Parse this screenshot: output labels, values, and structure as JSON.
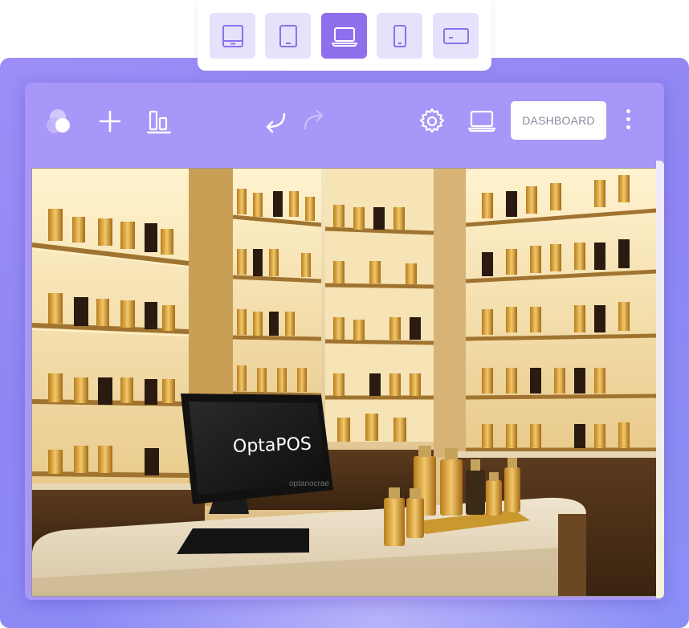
{
  "device_switcher": {
    "devices": [
      {
        "name": "desktop-monitor",
        "active": false
      },
      {
        "name": "tablet-portrait",
        "active": false
      },
      {
        "name": "laptop",
        "active": true
      },
      {
        "name": "mobile-portrait",
        "active": false
      },
      {
        "name": "tablet-landscape",
        "active": false
      }
    ]
  },
  "toolbar": {
    "icons": {
      "logo": "overlapping-circles-icon",
      "add": "plus-icon",
      "align": "align-bottom-icon",
      "undo": "undo-arrow-icon",
      "redo": "redo-arrow-icon",
      "settings": "gear-icon",
      "preview": "laptop-icon",
      "more": "kebab-menu-icon"
    },
    "dashboard_label": "DASHBOARD"
  },
  "preview_image": {
    "pos_screen_text": "OptaPOS",
    "pos_brand_text": "optanocrae"
  },
  "colors": {
    "accent": "#8d70ec",
    "accent_light": "#e6e2fb",
    "frame": "#9c8ef6",
    "toolbar": "#a896f8"
  }
}
